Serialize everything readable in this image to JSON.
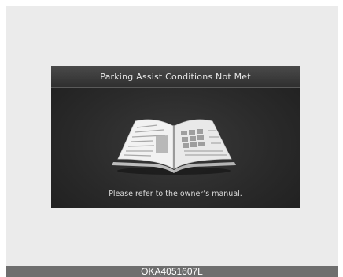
{
  "dialog": {
    "title": "Parking Assist Conditions Not Met",
    "message": "Please refer to the owner’s manual.",
    "icon": "open-book-icon"
  },
  "figure": {
    "code": "OKA4051607L"
  },
  "colors": {
    "screen_background": "#2a2a2a",
    "title_bar": "#3a3a3a",
    "text": "#e6e6e6",
    "panel_background": "#ebebeb",
    "caption_bar": "#6e6e6e"
  }
}
